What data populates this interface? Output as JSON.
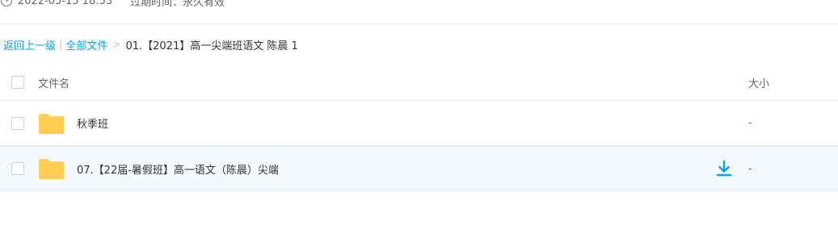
{
  "meta": {
    "date_text": "2022-05-15 18:53",
    "expire_text": "过期时间：永久有效"
  },
  "breadcrumb": {
    "back_label": "返回上一级",
    "separator_bar": "|",
    "all_files_label": "全部文件",
    "separator_gt": ">",
    "current_label": "01.【2021】高一尖端班语文 陈晨 1"
  },
  "table": {
    "columns": {
      "name_header": "文件名",
      "size_header": "大小"
    },
    "rows": [
      {
        "name": "秋季班",
        "size": "-",
        "icon": "folder-icon"
      },
      {
        "name": "07.【22届-暑假班】高一语文（陈晨）尖端",
        "size": "-",
        "icon": "folder-icon",
        "hovered": true
      }
    ]
  },
  "icons": {
    "clock": "clock-icon",
    "folder": "folder-icon",
    "download": "download-icon"
  },
  "colors": {
    "link_blue": "#0aa1ed",
    "folder_yellow": "#ffd15b",
    "row_hover": "#f3f9fd",
    "download_blue": "#0aa1ed"
  }
}
